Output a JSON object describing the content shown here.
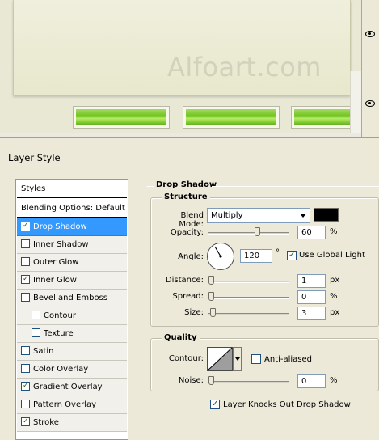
{
  "canvas": {
    "watermark": "Alfoart.com"
  },
  "dialog": {
    "title": "Layer Style"
  },
  "styles_list": {
    "items": [
      {
        "label": "Styles",
        "kind": "header"
      },
      {
        "label": "Blending Options: Default",
        "kind": "plain"
      },
      {
        "label": "Drop Shadow",
        "checked": true,
        "selected": true
      },
      {
        "label": "Inner Shadow",
        "checked": false
      },
      {
        "label": "Outer Glow",
        "checked": false
      },
      {
        "label": "Inner Glow",
        "checked": true
      },
      {
        "label": "Bevel and Emboss",
        "checked": false
      },
      {
        "label": "Contour",
        "checked": false,
        "indent": true
      },
      {
        "label": "Texture",
        "checked": false,
        "indent": true
      },
      {
        "label": "Satin",
        "checked": false
      },
      {
        "label": "Color Overlay",
        "checked": false
      },
      {
        "label": "Gradient Overlay",
        "checked": true
      },
      {
        "label": "Pattern Overlay",
        "checked": false
      },
      {
        "label": "Stroke",
        "checked": true
      }
    ]
  },
  "drop_shadow": {
    "title": "Drop Shadow",
    "structure": {
      "title": "Structure",
      "blend_mode_label": "Blend Mode:",
      "blend_mode_value": "Multiply",
      "shadow_color": "#000000",
      "opacity_label": "Opacity:",
      "opacity_value": "60",
      "opacity_unit": "%",
      "opacity_level": 0.6,
      "angle_label": "Angle:",
      "angle_value": "120",
      "angle_unit": "°",
      "use_global_light_label": "Use Global Light",
      "use_global_light": true,
      "distance_label": "Distance:",
      "distance_value": "1",
      "distance_unit": "px",
      "spread_label": "Spread:",
      "spread_value": "0",
      "spread_unit": "%",
      "size_label": "Size:",
      "size_value": "3",
      "size_unit": "px"
    },
    "quality": {
      "title": "Quality",
      "contour_label": "Contour:",
      "anti_aliased_label": "Anti-aliased",
      "anti_aliased": false,
      "noise_label": "Noise:",
      "noise_value": "0",
      "noise_unit": "%"
    },
    "knocks_out_label": "Layer Knocks Out Drop Shadow",
    "knocks_out": true
  }
}
